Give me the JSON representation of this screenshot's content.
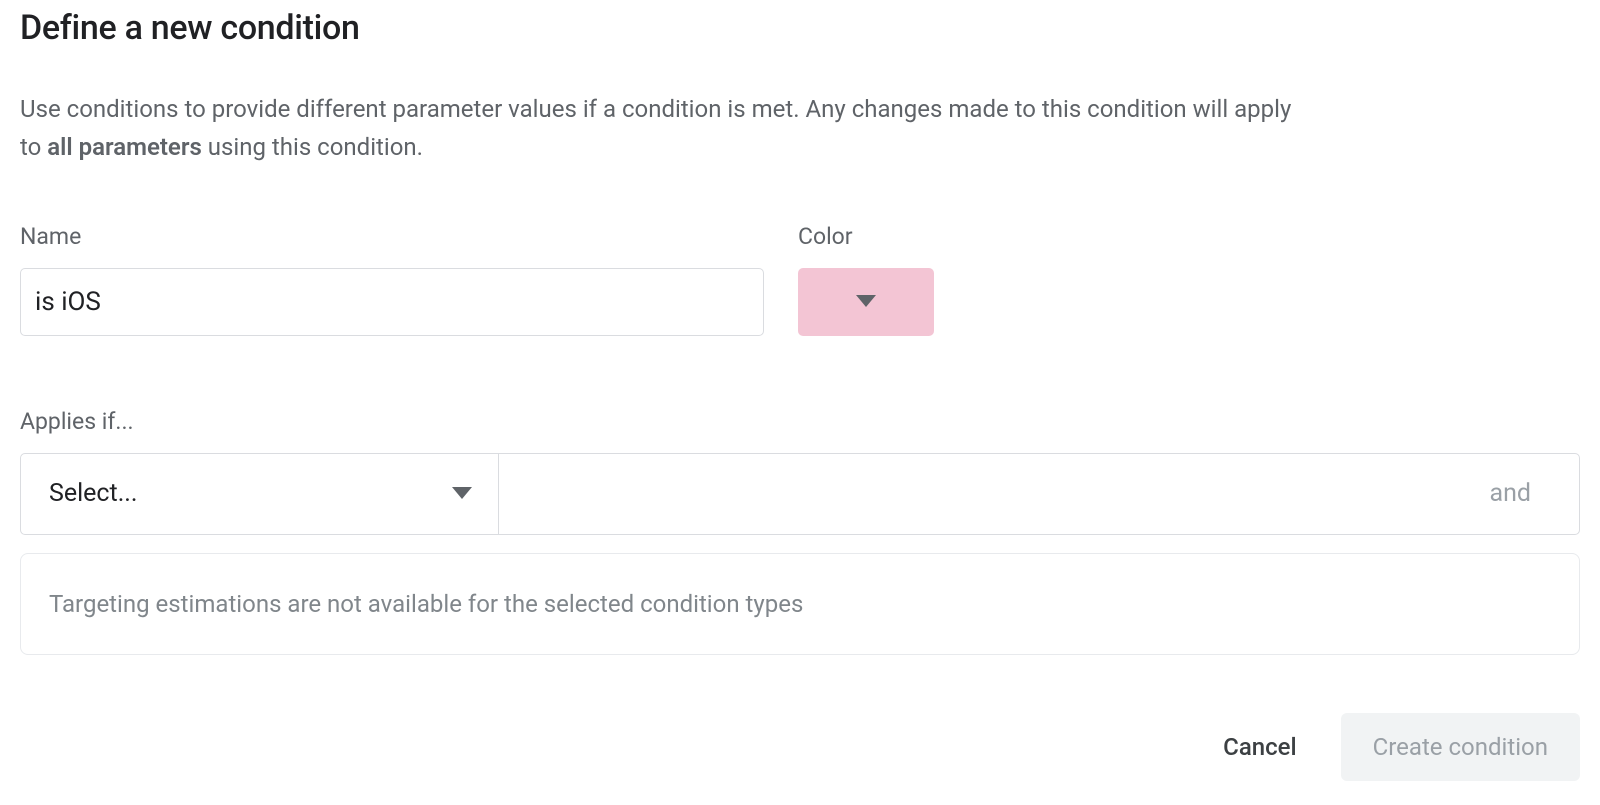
{
  "title": "Define a new condition",
  "description_part1": "Use conditions to provide different parameter values if a condition is met. Any changes made to this condition will apply to ",
  "description_bold": "all parameters",
  "description_part2": " using this condition.",
  "fields": {
    "name_label": "Name",
    "name_value": "is iOS",
    "color_label": "Color",
    "color_value": "#f3c5d4"
  },
  "applies_label": "Applies if...",
  "select_placeholder": "Select...",
  "and_text": "and",
  "info_message": "Targeting estimations are not available for the selected condition types",
  "buttons": {
    "cancel": "Cancel",
    "create": "Create condition"
  }
}
